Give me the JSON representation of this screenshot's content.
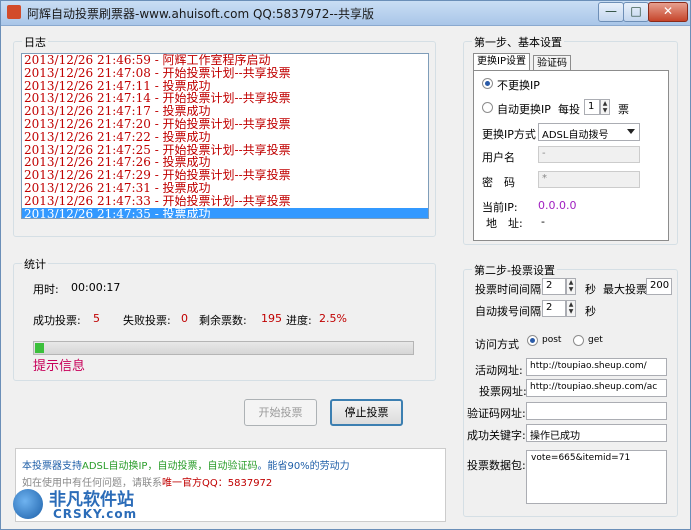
{
  "window": {
    "title": "阿辉自动投票刷票器-www.ahuisoft.com QQ:5837972--共享版",
    "minimize": "—",
    "maximize": "□",
    "close": "✕"
  },
  "log": {
    "label": "日志",
    "entries": [
      "2013/12/26 21:46:59  - 阿辉工作室程序启动",
      "2013/12/26 21:47:08  - 开始投票计划--共享投票",
      "2013/12/26 21:47:11  - 投票成功",
      "2013/12/26 21:47:14  - 开始投票计划--共享投票",
      "2013/12/26 21:47:17  - 投票成功",
      "2013/12/26 21:47:20  - 开始投票计划--共享投票",
      "2013/12/26 21:47:22  - 投票成功",
      "2013/12/26 21:47:25  - 开始投票计划--共享投票",
      "2013/12/26 21:47:26  - 投票成功",
      "2013/12/26 21:47:29  - 开始投票计划--共享投票",
      "2013/12/26 21:47:31  - 投票成功",
      "2013/12/26 21:47:33  - 开始投票计划--共享投票",
      "2013/12/26 21:47:35  - 投票成功"
    ]
  },
  "stats": {
    "label": "统计",
    "elapsed_label": "用时:",
    "elapsed_value": "00:00:17",
    "success_label": "成功投票:",
    "success_value": "5",
    "fail_label": "失败投票:",
    "fail_value": "0",
    "remaining_label": "剩余票数:",
    "remaining_value": "195",
    "progress_label": "进度:",
    "progress_value": "2.5%",
    "progress_fraction": 0.025,
    "hint": "提示信息"
  },
  "actions": {
    "start": "开始投票",
    "stop": "停止投票"
  },
  "info": {
    "line1_a": "本投票器支持",
    "line1_b": "ADSL自动换IP，自动投票，自动验证码",
    "line1_c": "。能省90%的劳动力",
    "line2_a": "如在使用中有任何问题，请联系",
    "line2_b": "唯一官方QQ：5837972"
  },
  "step1": {
    "label": "第一步、基本设置",
    "tab_ip": "更换IP设置",
    "tab_captcha": "验证码",
    "radio_no_change": "不更换IP",
    "radio_auto": "自动更换IP",
    "every_label": "每投",
    "every_value": "1",
    "every_unit": "票",
    "method_label": "更换IP方式",
    "method_value": "ADSL自动拨号",
    "user_label": "用户名",
    "user_value": "-",
    "pwd_label": "密　码",
    "pwd_value": "*",
    "current_ip_label": "当前IP:",
    "current_ip_value": "0.0.0.0",
    "address_label": "地　址:",
    "address_value": "-"
  },
  "step2": {
    "label": "第二步-投票设置",
    "interval_label": "投票时间间隔",
    "interval_value": "2",
    "interval_unit": "秒",
    "max_label": "最大投票",
    "max_value": "200",
    "redial_label": "自动拨号间隔",
    "redial_value": "2",
    "redial_unit": "秒",
    "method_label": "访问方式",
    "post": "post",
    "get": "get",
    "activity_url_label": "活动网址:",
    "activity_url_value": "http://toupiao.sheup.com/",
    "vote_url_label": "投票网址:",
    "vote_url_value": "http://toupiao.sheup.com/ac",
    "captcha_url_label": "验证码网址:",
    "captcha_url_value": "",
    "success_kw_label": "成功关键字:",
    "success_kw_value": "操作已成功",
    "packet_label": "投票数据包:",
    "packet_value": "vote=665&itemid=71"
  },
  "watermark": {
    "cn": "非凡软件站",
    "en": "CRSKY.com"
  }
}
